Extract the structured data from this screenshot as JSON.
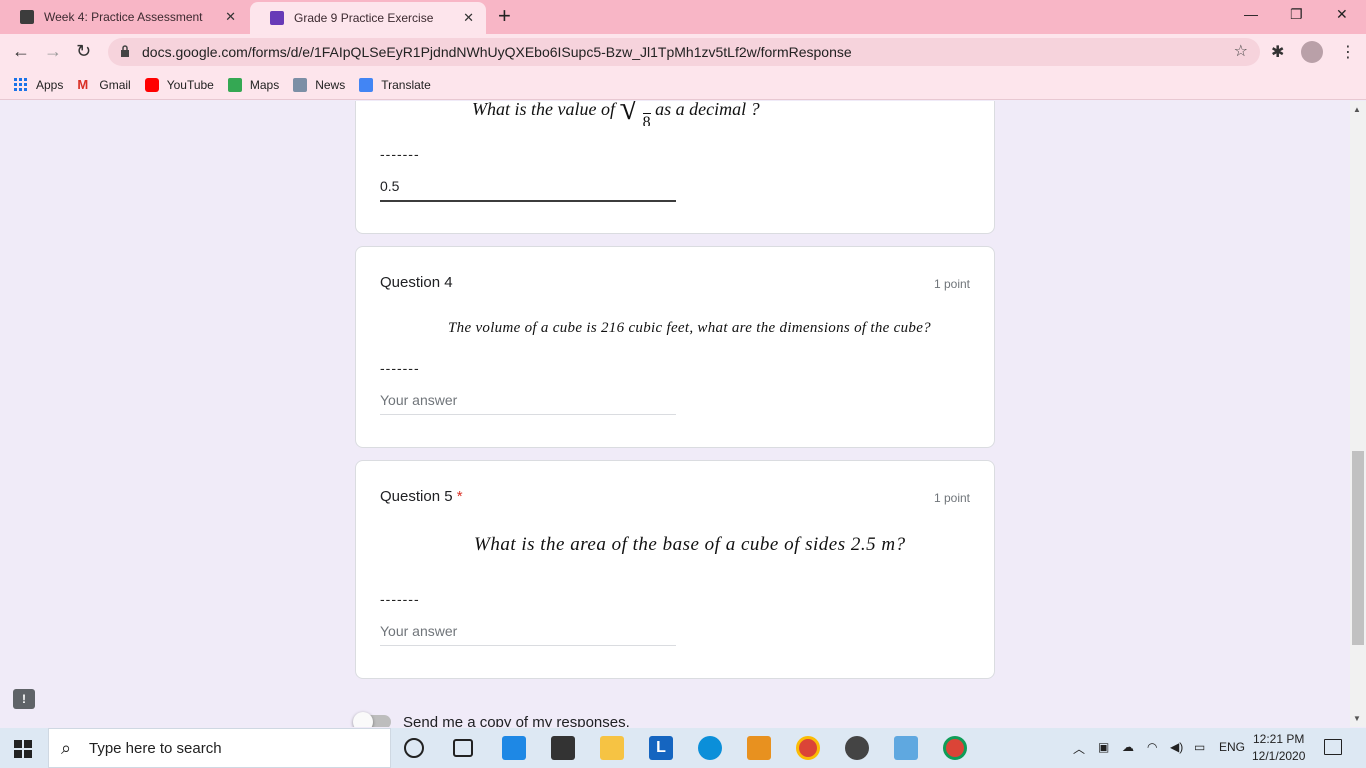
{
  "browser": {
    "tabs": [
      {
        "title": "Week 4: Practice Assessment",
        "active": false
      },
      {
        "title": "Grade 9 Practice Exercise",
        "active": true
      }
    ],
    "url": "docs.google.com/forms/d/e/1FAIpQLSeEyR1PjdndNWhUyQXEbo6ISupc5-Bzw_Jl1TpMh1zv5tLf2w/formResponse",
    "bookmarks": [
      "Apps",
      "Gmail",
      "YouTube",
      "Maps",
      "News",
      "Translate"
    ]
  },
  "form": {
    "q3": {
      "question_fragment_left": "What is the value of",
      "fraction_denominator": "8",
      "question_fragment_right": "as a decimal ?",
      "dashes": "-------",
      "answer": "0.5"
    },
    "q4": {
      "title": "Question 4",
      "points": "1 point",
      "question": "The volume of a cube is 216 cubic feet, what are the dimensions of the cube?",
      "dashes": "-------",
      "placeholder": "Your answer"
    },
    "q5": {
      "title": "Question 5",
      "required_marker": "*",
      "points": "1 point",
      "question": "What is the area of the base of a cube of sides 2.5 m?",
      "dashes": "-------",
      "placeholder": "Your answer"
    },
    "copy_toggle_label": "Send me a copy of my responses."
  },
  "taskbar": {
    "search_placeholder": "Type here to search",
    "language": "ENG",
    "time": "12:21 PM",
    "date": "12/1/2020"
  }
}
